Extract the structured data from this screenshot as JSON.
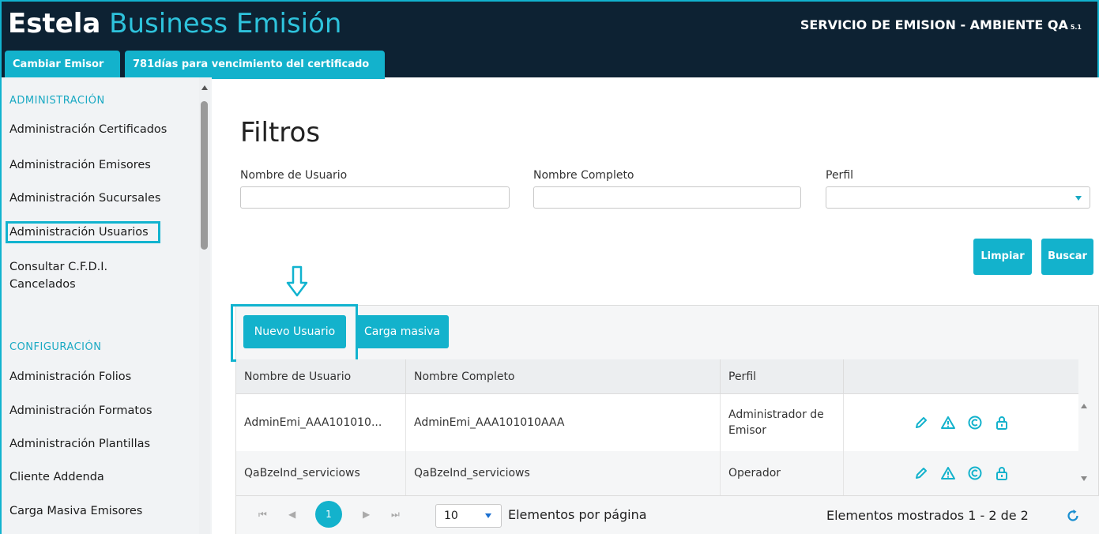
{
  "header": {
    "brand_bold": "Estela",
    "brand_rest": " Business Emisión",
    "service": "SERVICIO DE EMISION - AMBIENTE QA",
    "version": "5.1",
    "tabs": [
      {
        "label": "Cambiar Emisor"
      },
      {
        "label": "781días para vencimiento del certificado"
      }
    ]
  },
  "sidebar": {
    "sections": [
      {
        "title": "ADMINISTRACIÓN"
      },
      {
        "title": "CONFIGURACIÓN"
      }
    ],
    "items": [
      {
        "label": "Administración Certificados"
      },
      {
        "label": "Administración Emisores"
      },
      {
        "label": "Administración Sucursales"
      },
      {
        "label": "Administración Usuarios"
      },
      {
        "label": "Consultar C.F.D.I. Cancelados"
      },
      {
        "label": "Administración Folios"
      },
      {
        "label": "Administración Formatos"
      },
      {
        "label": "Administración Plantillas"
      },
      {
        "label": "Cliente Addenda"
      },
      {
        "label": "Carga Masiva Emisores"
      }
    ]
  },
  "filters": {
    "title": "Filtros",
    "user_label": "Nombre de Usuario",
    "user_value": "",
    "fullname_label": "Nombre Completo",
    "fullname_value": "",
    "profile_label": "Perfil",
    "profile_value": "",
    "clear_label": "Limpiar",
    "search_label": "Buscar"
  },
  "toolbar": {
    "new_user_label": "Nuevo Usuario",
    "bulk_label": "Carga masiva"
  },
  "table": {
    "columns": [
      "Nombre de Usuario",
      "Nombre Completo",
      "Perfil",
      ""
    ],
    "rows": [
      {
        "user": "AdminEmi_AAA101010...",
        "fullname": "AdminEmi_AAA101010AAA",
        "profile": "Administrador de Emisor"
      },
      {
        "user": "QaBzeInd_serviciows",
        "fullname": "QaBzeInd_serviciows",
        "profile": "Operador"
      }
    ],
    "row_actions": [
      "pencil-icon",
      "warning-icon",
      "copyright-icon",
      "lock-icon"
    ]
  },
  "pager": {
    "current_page": "1",
    "page_size": "10",
    "page_size_label": "Elementos por página",
    "info": "Elementos mostrados 1 - 2 de 2"
  },
  "colors": {
    "accent": "#13b2cc",
    "header_bg": "#0d2233",
    "highlight": "#11b3cf"
  }
}
